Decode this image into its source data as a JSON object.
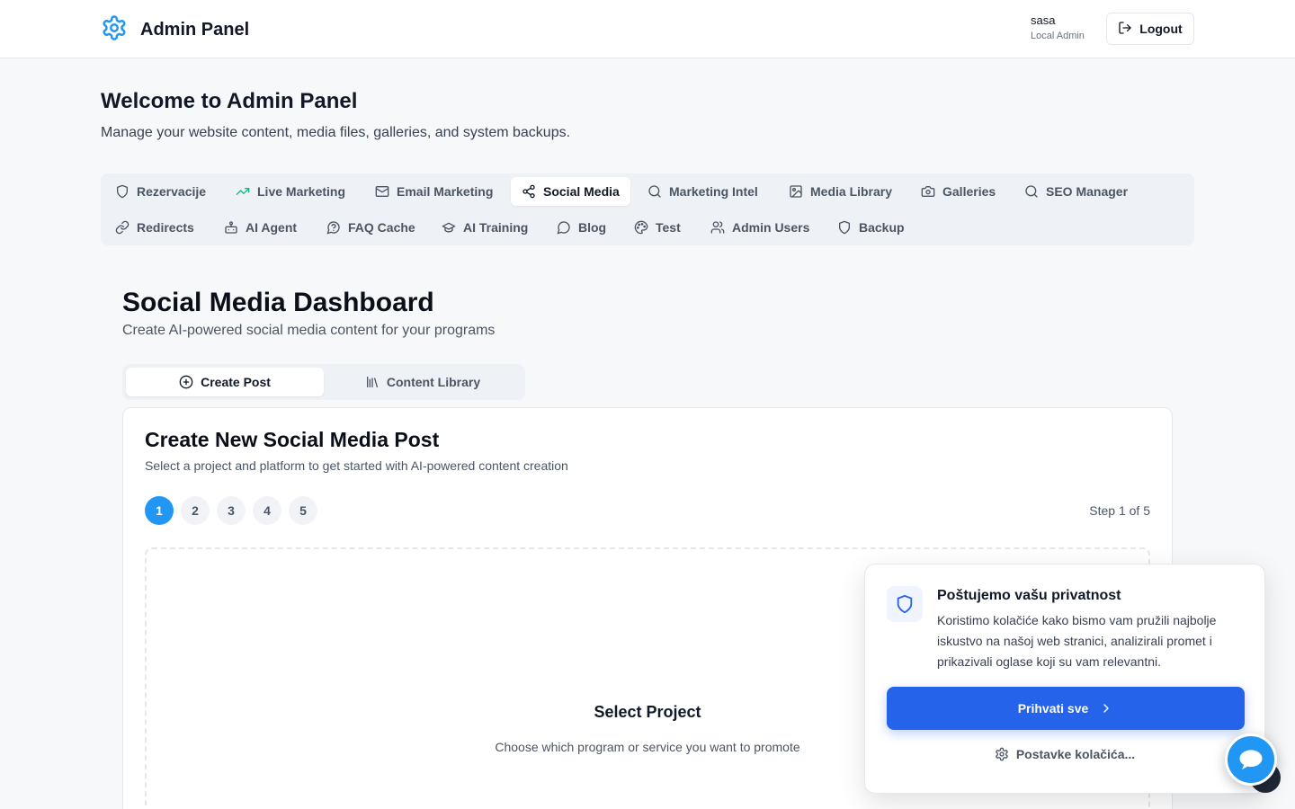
{
  "header": {
    "brand_title": "Admin Panel",
    "brand_icon": "gear-icon",
    "user_name": "sasa",
    "user_role": "Local Admin",
    "logout_label": "Logout"
  },
  "welcome": {
    "title": "Welcome to Admin Panel",
    "subtitle": "Manage your website content, media files, galleries, and system backups."
  },
  "nav": {
    "items": [
      {
        "label": "Rezervacije",
        "icon": "shield-icon"
      },
      {
        "label": "Live Marketing",
        "icon": "trending-up-icon"
      },
      {
        "label": "Email Marketing",
        "icon": "mail-icon"
      },
      {
        "label": "Social Media",
        "icon": "share-icon",
        "active": true
      },
      {
        "label": "Marketing Intel",
        "icon": "search-icon"
      },
      {
        "label": "Media Library",
        "icon": "image-icon"
      },
      {
        "label": "Galleries",
        "icon": "camera-icon"
      },
      {
        "label": "SEO Manager",
        "icon": "search-icon"
      },
      {
        "label": "Redirects",
        "icon": "link-icon"
      },
      {
        "label": "AI Agent",
        "icon": "bot-icon"
      },
      {
        "label": "FAQ Cache",
        "icon": "help-bubble-icon"
      },
      {
        "label": "AI Training",
        "icon": "graduation-cap-icon"
      },
      {
        "label": "Blog",
        "icon": "message-bubble-icon"
      },
      {
        "label": "Test",
        "icon": "palette-icon"
      },
      {
        "label": "Admin Users",
        "icon": "users-icon"
      },
      {
        "label": "Backup",
        "icon": "shield-icon"
      }
    ]
  },
  "dashboard": {
    "title": "Social Media Dashboard",
    "subtitle": "Create AI-powered social media content for your programs",
    "tabs": [
      {
        "label": "Create Post",
        "icon": "plus-circle-icon",
        "active": true
      },
      {
        "label": "Content Library",
        "icon": "library-icon"
      }
    ]
  },
  "card": {
    "title": "Create New Social Media Post",
    "subtitle": "Select a project and platform to get started with AI-powered content creation",
    "steps": [
      "1",
      "2",
      "3",
      "4",
      "5"
    ],
    "step_label": "Step 1 of 5",
    "dropzone_title": "Select Project",
    "dropzone_subtitle": "Choose which program or service you want to promote"
  },
  "cookie": {
    "title": "Poštujemo vašu privatnost",
    "text": "Koristimo kolačiće kako bismo vam pružili najbolje iskustvo na našoj web stranici, analizirali promet i prikazivali oglase koji su vam relevantni.",
    "accept_label": "Prihvati sve",
    "settings_label": "Postavke kolačića..."
  },
  "colors": {
    "accent": "#2563eb",
    "step_active": "#2196f3",
    "trend_green": "#10b981"
  }
}
